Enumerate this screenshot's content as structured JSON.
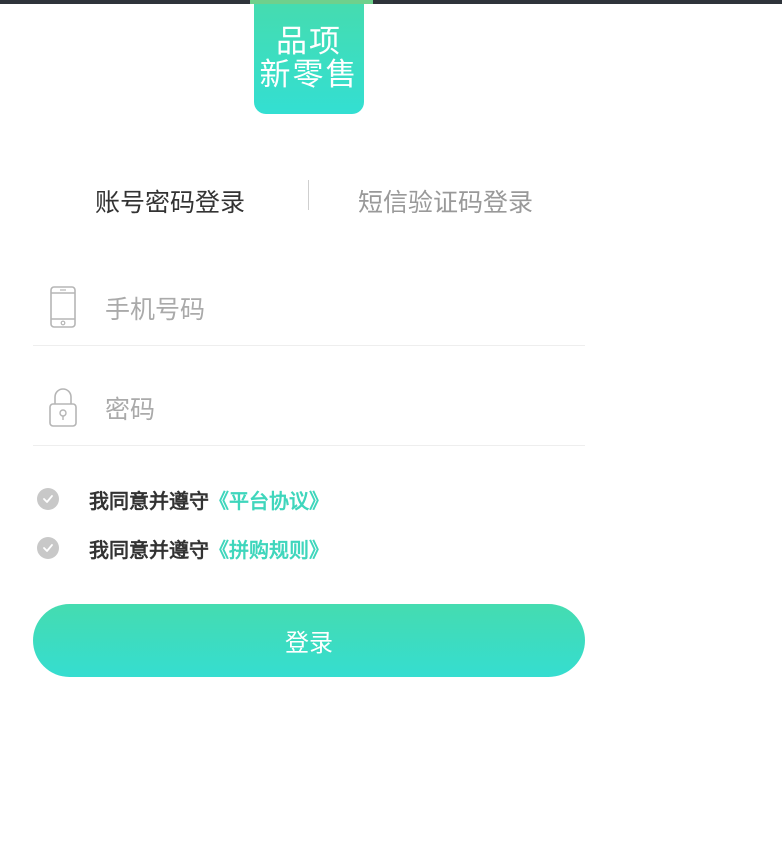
{
  "brand": {
    "logo_line1": "品项",
    "logo_line2": "新零售",
    "accent_color": "#3fd6bc"
  },
  "tabs": [
    {
      "label": "账号密码登录",
      "active": true
    },
    {
      "label": "短信验证码登录",
      "active": false
    }
  ],
  "form": {
    "phone_placeholder": "手机号码",
    "phone_value": "",
    "password_placeholder": "密码",
    "password_value": "",
    "phone_icon": "phone-icon",
    "lock_icon": "lock-icon"
  },
  "agreements": [
    {
      "text": "我同意并遵守",
      "link": "《平台协议》",
      "checked": false
    },
    {
      "text": "我同意并遵守",
      "link": "《拼购规则》",
      "checked": false
    }
  ],
  "login_button": "登录"
}
